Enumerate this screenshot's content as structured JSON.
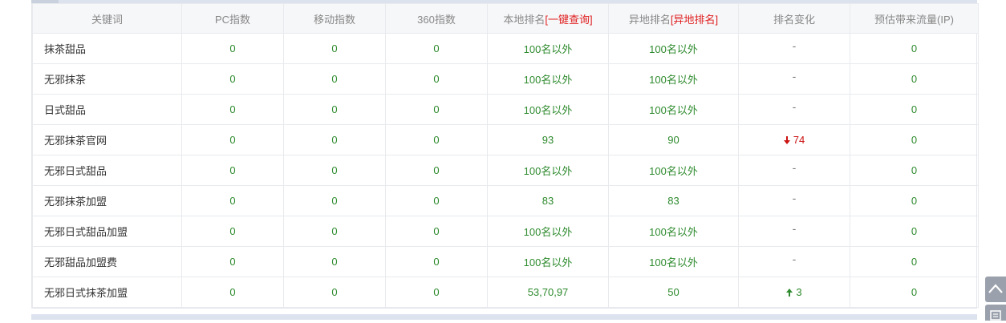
{
  "columns": {
    "keyword": "关键词",
    "pc": "PC指数",
    "mobile": "移动指数",
    "index360": "360指数",
    "local_prefix": "本地排名",
    "local_link": "[一键查询]",
    "remote_prefix": "异地排名",
    "remote_link": "[异地排名]",
    "change": "排名变化",
    "traffic": "预估带来流量(IP)"
  },
  "rows": [
    {
      "keyword": "抹茶甜品",
      "pc": "0",
      "mobile": "0",
      "index360": "0",
      "local": "100名以外",
      "remote": "100名以外",
      "change": "-",
      "change_dir": "none",
      "traffic": "0"
    },
    {
      "keyword": "无邪抹茶",
      "pc": "0",
      "mobile": "0",
      "index360": "0",
      "local": "100名以外",
      "remote": "100名以外",
      "change": "-",
      "change_dir": "none",
      "traffic": "0"
    },
    {
      "keyword": "日式甜品",
      "pc": "0",
      "mobile": "0",
      "index360": "0",
      "local": "100名以外",
      "remote": "100名以外",
      "change": "-",
      "change_dir": "none",
      "traffic": "0"
    },
    {
      "keyword": "无邪抹茶官网",
      "pc": "0",
      "mobile": "0",
      "index360": "0",
      "local": "93",
      "remote": "90",
      "change": "74",
      "change_dir": "down",
      "traffic": "0"
    },
    {
      "keyword": "无邪日式甜品",
      "pc": "0",
      "mobile": "0",
      "index360": "0",
      "local": "100名以外",
      "remote": "100名以外",
      "change": "-",
      "change_dir": "none",
      "traffic": "0"
    },
    {
      "keyword": "无邪抹茶加盟",
      "pc": "0",
      "mobile": "0",
      "index360": "0",
      "local": "83",
      "remote": "83",
      "change": "-",
      "change_dir": "none",
      "traffic": "0"
    },
    {
      "keyword": "无邪日式甜品加盟",
      "pc": "0",
      "mobile": "0",
      "index360": "0",
      "local": "100名以外",
      "remote": "100名以外",
      "change": "-",
      "change_dir": "none",
      "traffic": "0"
    },
    {
      "keyword": "无邪甜品加盟费",
      "pc": "0",
      "mobile": "0",
      "index360": "0",
      "local": "100名以外",
      "remote": "100名以外",
      "change": "-",
      "change_dir": "none",
      "traffic": "0"
    },
    {
      "keyword": "无邪日式抹茶加盟",
      "pc": "0",
      "mobile": "0",
      "index360": "0",
      "local": "53,70,97",
      "remote": "50",
      "change": "3",
      "change_dir": "up",
      "traffic": "0"
    }
  ],
  "icons": {
    "down": "arrow-down-icon",
    "up": "arrow-up-icon",
    "back_to_top": "chevron-up-icon",
    "feedback": "edit-icon"
  },
  "colors": {
    "value_green": "#2d8a2d",
    "link_red": "#e02020",
    "header_bg": "#f6f7f9",
    "side_button": "#9aa1ac"
  }
}
